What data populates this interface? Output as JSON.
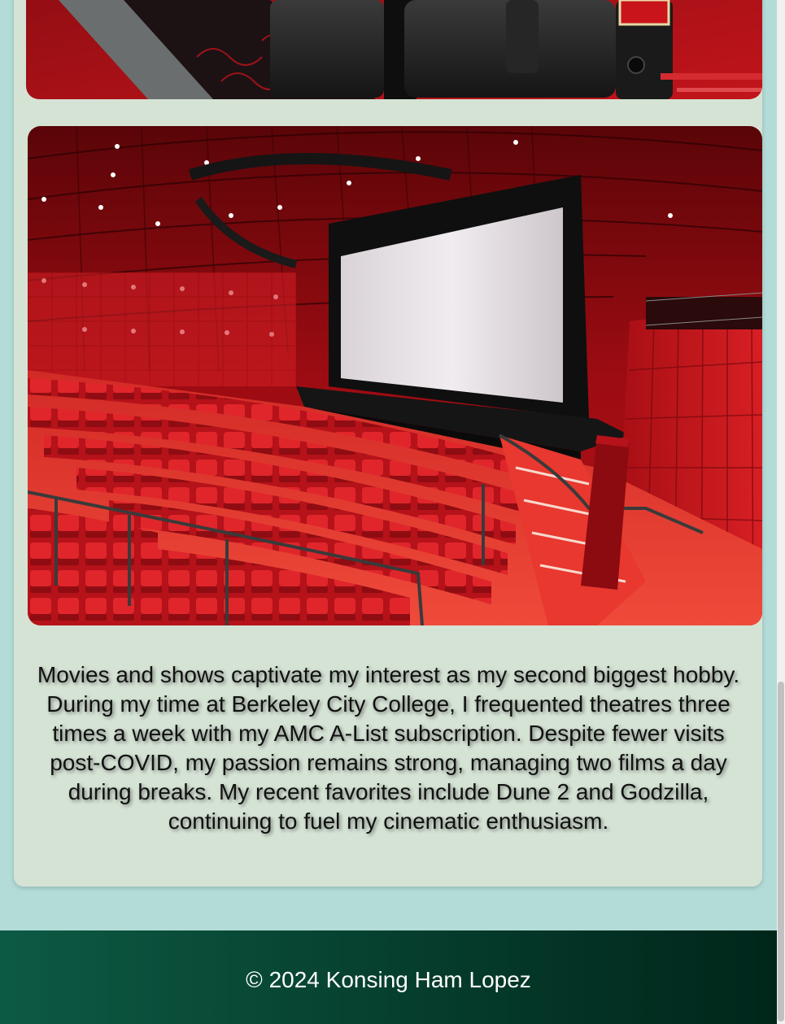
{
  "hobby_section": {
    "images": [
      {
        "name": "theater-seats-photo",
        "alt": "Cinema recliner seats"
      },
      {
        "name": "theater-auditorium-photo",
        "alt": "Red cinema auditorium with large screen"
      }
    ],
    "description": "Movies and shows captivate my interest as my second biggest hobby. During my time at Berkeley City College, I frequented theatres three times a week with my AMC A-List subscription. Despite fewer visits post-COVID, my passion remains strong, managing two films a day during breaks. My recent favorites include Dune 2 and Godzilla, continuing to fuel my cinematic enthusiasm."
  },
  "footer": {
    "copyright": "© 2024 Konsing Ham Lopez"
  },
  "colors": {
    "page_background": "#b3dcd8",
    "card_background": "#d5e3d5",
    "footer_dark": "#00261a",
    "footer_light": "#0d5a44",
    "theater_red": "#c8141a"
  }
}
